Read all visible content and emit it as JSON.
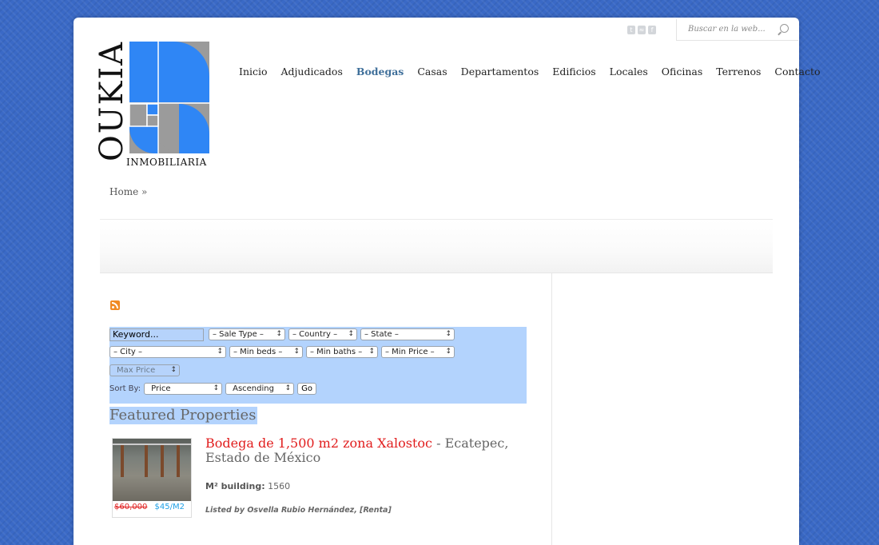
{
  "colors": {
    "background": "#3a69c6",
    "logo_blue": "#2f86f5",
    "logo_gray": "#9b9b9b",
    "nav_active": "#3f6f9a",
    "title_red": "#e11d1d",
    "price_new": "#1fa0e6",
    "form_bg": "#b3d3fd"
  },
  "header": {
    "social_icons": [
      "twitter-icon",
      "rss-icon",
      "facebook-icon"
    ],
    "search_placeholder": "Buscar en la web...",
    "logo": {
      "main_text": "OUKIA",
      "sub_text": "INMOBILIARIA"
    }
  },
  "nav": {
    "items": [
      {
        "label": "Inicio",
        "active": false
      },
      {
        "label": "Adjudicados",
        "active": false
      },
      {
        "label": "Bodegas",
        "active": true
      },
      {
        "label": "Casas",
        "active": false
      },
      {
        "label": "Departamentos",
        "active": false
      },
      {
        "label": "Edificios",
        "active": false
      },
      {
        "label": "Locales",
        "active": false
      },
      {
        "label": "Oficinas",
        "active": false
      },
      {
        "label": "Terrenos",
        "active": false
      },
      {
        "label": "Contacto",
        "active": false
      }
    ]
  },
  "breadcrumb": {
    "home": "Home",
    "sep": "»"
  },
  "search_form": {
    "keyword": "Keyword...",
    "sale_type": "– Sale Type –",
    "country": "– Country –",
    "state": "– State –",
    "city": "– City –",
    "min_beds": "– Min beds –",
    "min_baths": "– Min baths –",
    "min_price": "– Min Price –",
    "max_price": "Max Price",
    "sort_label": "Sort By:",
    "sort_value": "Price",
    "order_value": "Ascending",
    "go_label": "Go"
  },
  "featured": {
    "heading": "Featured Properties",
    "listings": [
      {
        "title": "Bodega de 1,500 m2 zona Xalostoc",
        "location": " - Ecatepec, Estado de México",
        "old_price": "$60,000",
        "new_price": "$45/M2",
        "building_label": "M² building:",
        "building_value": "1560",
        "listed_by": "Listed by Osvella Rubio Hernández, [Renta]"
      }
    ]
  }
}
